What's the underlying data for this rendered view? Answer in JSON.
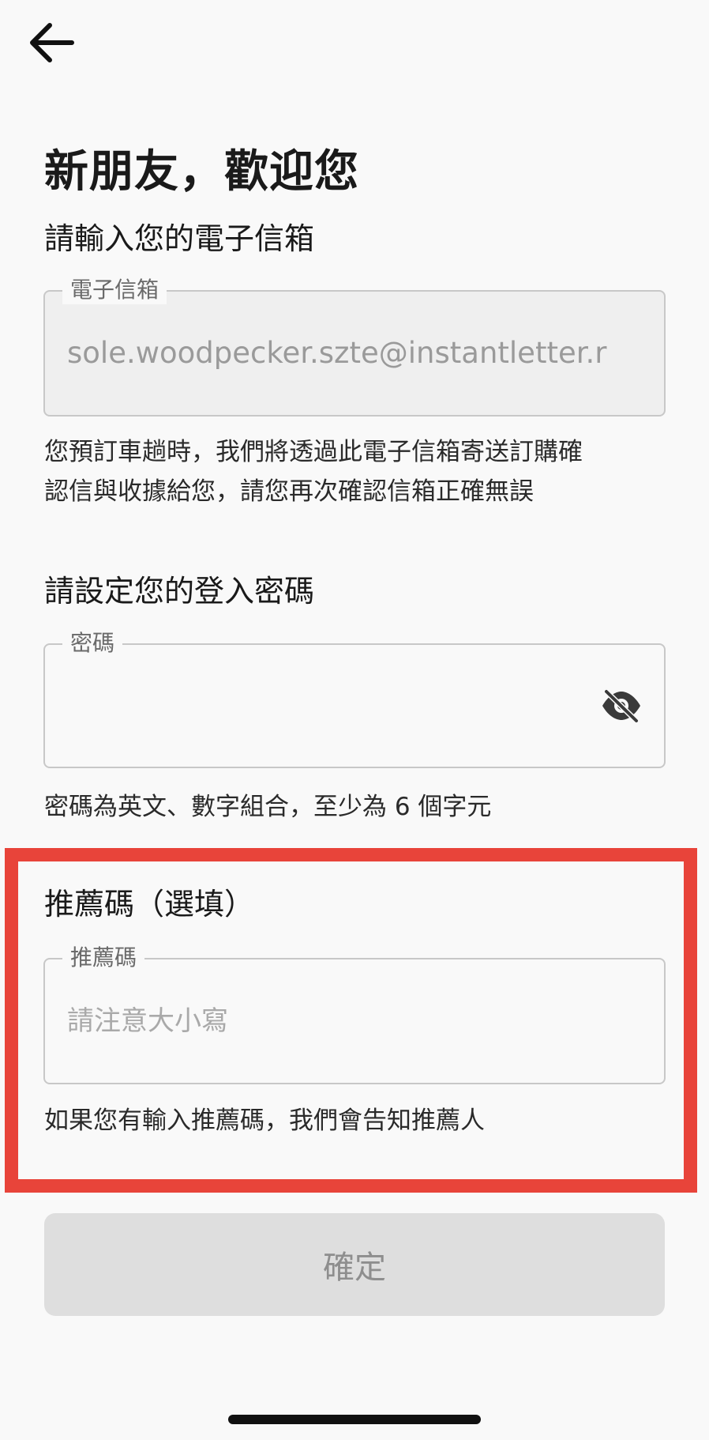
{
  "header": {
    "back_icon": "arrow-left-icon"
  },
  "title": "新朋友，歡迎您",
  "email_section": {
    "label": "請輸入您的電子信箱",
    "field_label": "電子信箱",
    "value": "sole.woodpecker.szte@instantletter.r",
    "helper_line1": "您預訂車趟時，我們將透過此電子信箱寄送訂購確",
    "helper_line2": "認信與收據給您，請您再次確認信箱正確無誤"
  },
  "password_section": {
    "label": "請設定您的登入密碼",
    "field_label": "密碼",
    "value": "",
    "toggle_icon": "eye-off-icon",
    "helper": "密碼為英文、數字組合，至少為 6 個字元"
  },
  "referral_section": {
    "label": "推薦碼（選填）",
    "field_label": "推薦碼",
    "placeholder": "請注意大小寫",
    "helper": "如果您有輸入推薦碼，我們會告知推薦人"
  },
  "confirm_button": {
    "label": "確定"
  },
  "colors": {
    "highlight": "#e8443a",
    "background": "#f9f9f9",
    "button_disabled": "#dedede"
  }
}
